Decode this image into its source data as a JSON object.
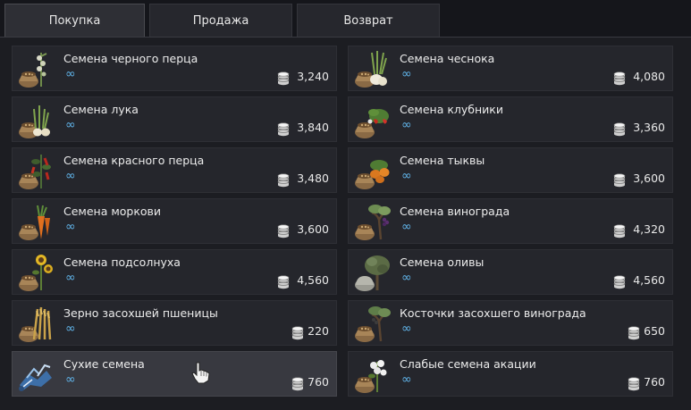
{
  "tabs": [
    {
      "label": "Покупка",
      "active": true
    },
    {
      "label": "Продажа",
      "active": false
    },
    {
      "label": "Возврат",
      "active": false
    }
  ],
  "stock_symbol": "∞",
  "left_items": [
    {
      "name": "Семена черного перца",
      "price": "3,240",
      "icon": "black-pepper-seed-icon"
    },
    {
      "name": "Семена лука",
      "price": "3,840",
      "icon": "onion-seed-icon"
    },
    {
      "name": "Семена красного перца",
      "price": "3,480",
      "icon": "red-pepper-seed-icon"
    },
    {
      "name": "Семена моркови",
      "price": "3,600",
      "icon": "carrot-seed-icon"
    },
    {
      "name": "Семена подсолнуха",
      "price": "4,560",
      "icon": "sunflower-seed-icon"
    },
    {
      "name": "Зерно засохшей пшеницы",
      "price": "220",
      "icon": "wheat-grain-icon"
    },
    {
      "name": "Сухие семена",
      "price": "760",
      "icon": "dry-seeds-icon"
    }
  ],
  "right_items": [
    {
      "name": "Семена чеснока",
      "price": "4,080",
      "icon": "garlic-seed-icon"
    },
    {
      "name": "Семена клубники",
      "price": "3,360",
      "icon": "strawberry-seed-icon"
    },
    {
      "name": "Семена тыквы",
      "price": "3,600",
      "icon": "pumpkin-seed-icon"
    },
    {
      "name": "Семена винограда",
      "price": "4,320",
      "icon": "grape-seed-icon"
    },
    {
      "name": "Семена оливы",
      "price": "4,560",
      "icon": "olive-seed-icon"
    },
    {
      "name": "Косточки засохшего винограда",
      "price": "650",
      "icon": "grape-pit-icon"
    },
    {
      "name": "Слабые семена акации",
      "price": "760",
      "icon": "acacia-seed-icon"
    }
  ],
  "colors": {
    "accent_infinity": "#5fb1e6",
    "hover_row": "#383940",
    "row": "#25262c"
  }
}
